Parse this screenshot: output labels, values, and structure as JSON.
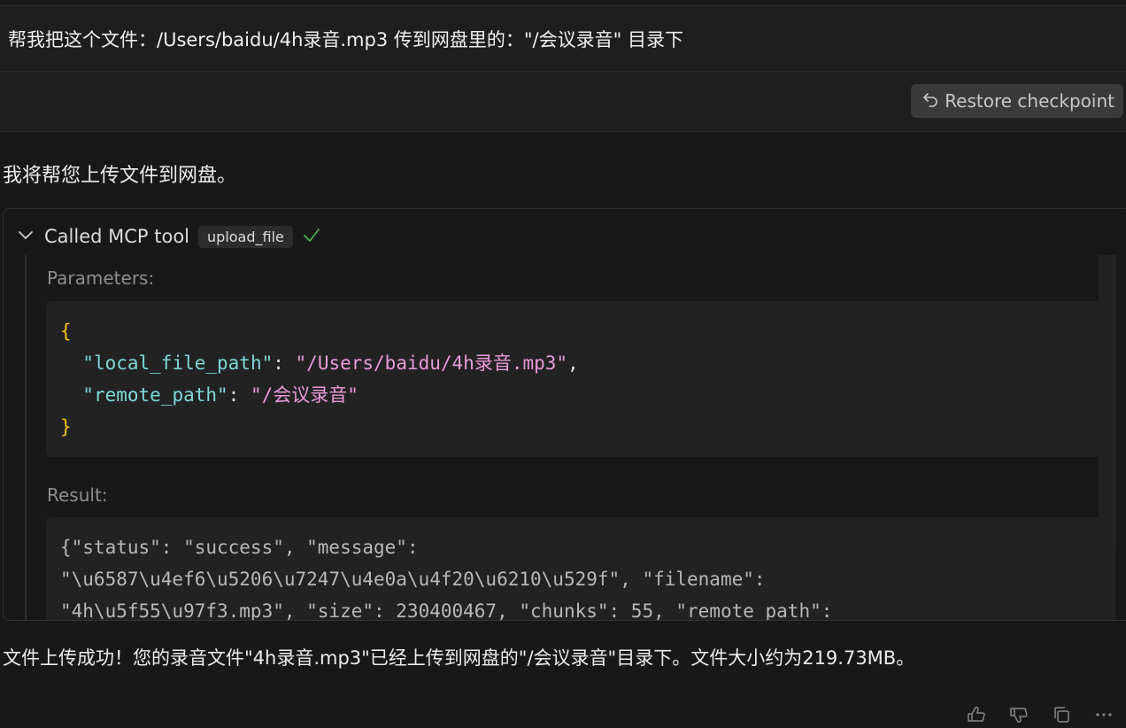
{
  "user": {
    "message": "帮我把这个文件：/Users/baidu/4h录音.mp3 传到网盘里的：\"/会议录音\" 目录下",
    "restore_label": "Restore checkpoint"
  },
  "assistant": {
    "intro": "我将帮您上传文件到网盘。",
    "tool_call": {
      "title": "Called MCP tool",
      "tool_name": "upload_file",
      "parameters_label": "Parameters:",
      "params": {
        "open_brace": "{",
        "close_brace": "}",
        "local_key": "\"local_file_path\"",
        "local_value": "\"/Users/baidu/4h录音.mp3\"",
        "remote_key": "\"remote_path\"",
        "remote_value": "\"/会议录音\""
      },
      "result_label": "Result:",
      "result_lines": [
        "{\"status\": \"success\", \"message\":",
        "\"\\u6587\\u4ef6\\u5206\\u7247\\u4e0a\\u4f20\\u6210\\u529f\", \"filename\":",
        "\"4h\\u5f55\\u97f3.mp3\", \"size\": 230400467, \"chunks\": 55, \"remote_path\":"
      ]
    },
    "final": "文件上传成功！您的录音文件\"4h录音.mp3\"已经上传到网盘的\"/会议录音\"目录下。文件大小约为219.73MB。"
  },
  "icons": [
    "restore-icon",
    "chevron-down-icon",
    "check-icon",
    "thumbs-up-icon",
    "thumbs-down-icon",
    "copy-icon",
    "more-icon"
  ],
  "colors": {
    "background": "#181818",
    "json_brace": "#f5c518",
    "json_key": "#7fd8d8",
    "json_string": "#e99ad8",
    "check": "#4caf50"
  }
}
